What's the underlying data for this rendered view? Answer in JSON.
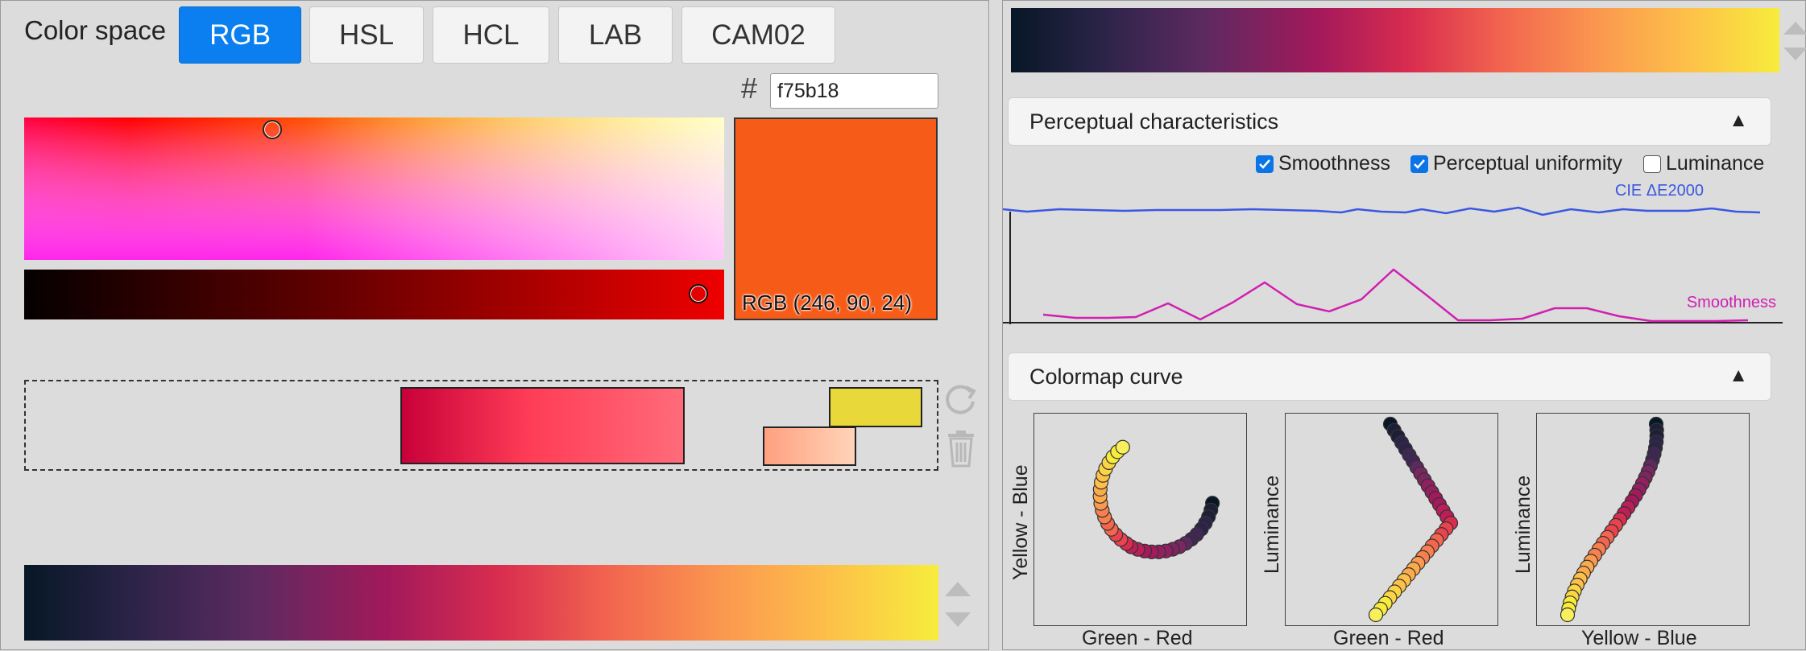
{
  "color_space": {
    "label": "Color space",
    "tabs": [
      {
        "label": "RGB",
        "active": true
      },
      {
        "label": "HSL",
        "active": false
      },
      {
        "label": "HCL",
        "active": false
      },
      {
        "label": "LAB",
        "active": false
      },
      {
        "label": "CAM02",
        "active": false
      }
    ]
  },
  "picker": {
    "hash_symbol": "#",
    "hex_value": "f75b18",
    "current_color": "#f75b18",
    "rgb_readout": "RGB (246, 90, 24)"
  },
  "stops": [
    {
      "name": "crimson-to-salmon",
      "from": "#c8003a",
      "to": "#ff6b7a"
    },
    {
      "name": "yellow",
      "from": "#e8d83a",
      "to": "#e8d83a"
    },
    {
      "name": "peach",
      "from": "#ffa080",
      "to": "#ffd4b8"
    }
  ],
  "icons": {
    "refresh": "refresh-icon",
    "trash": "trash-icon",
    "up": "chevron-up-icon",
    "down": "chevron-down-icon",
    "collapse": "triangle-up-icon"
  },
  "perceptual": {
    "title": "Perceptual characteristics",
    "collapse_glyph": "▲",
    "checkboxes": [
      {
        "label": "Smoothness",
        "checked": true
      },
      {
        "label": "Perceptual uniformity",
        "checked": true
      },
      {
        "label": "Luminance",
        "checked": false
      }
    ],
    "uniformity_label": "CIE ΔE2000",
    "smoothness_label": "Smoothness",
    "uniformity_color": "#3a57e0",
    "smoothness_color": "#d020b0"
  },
  "curve": {
    "title": "Colormap curve",
    "collapse_glyph": "▲",
    "plots": [
      {
        "xlabel": "Green - Red",
        "ylabel": "Yellow - Blue"
      },
      {
        "xlabel": "Green - Red",
        "ylabel": "Luminance"
      },
      {
        "xlabel": "Yellow - Blue",
        "ylabel": "Luminance"
      }
    ]
  }
}
